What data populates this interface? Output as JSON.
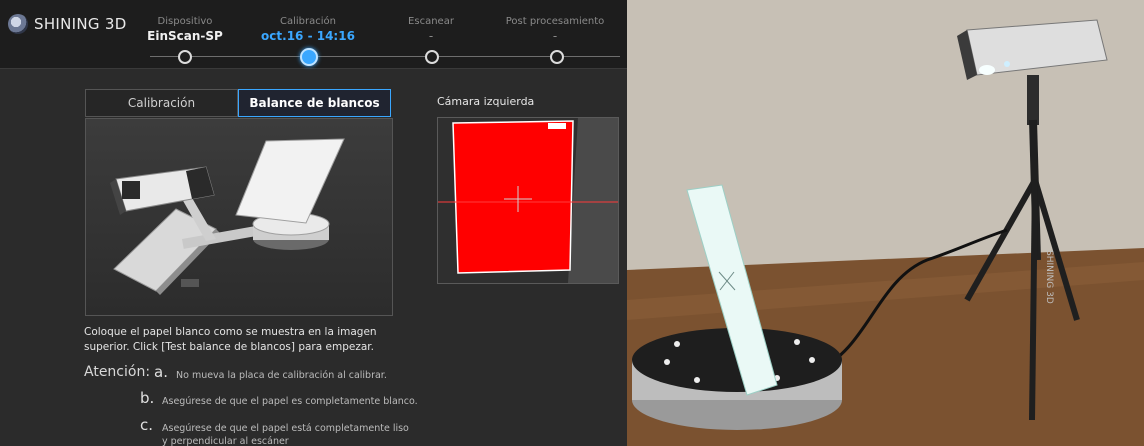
{
  "brand": {
    "name": "SHINING 3D"
  },
  "steps": [
    {
      "label": "Dispositivo",
      "value": "EinScan-SP",
      "state": "done"
    },
    {
      "label": "Calibración",
      "value": "oct.16 - 14:16",
      "state": "active"
    },
    {
      "label": "Escanear",
      "value": "-",
      "state": "pending"
    },
    {
      "label": "Post procesamiento",
      "value": "-",
      "state": "pending"
    }
  ],
  "tabs": {
    "calibration": "Calibración",
    "white_balance": "Balance de blancos"
  },
  "camera": {
    "label": "Cámara izquierda"
  },
  "instructions": {
    "main": "Coloque el papel blanco como se muestra en la imagen superior. Click [Test balance de blancos] para empezar.",
    "attention_label": "Atención:",
    "items": [
      {
        "letter": "a.",
        "text": "No mueva la placa de calibración al calibrar."
      },
      {
        "letter": "b.",
        "text": "Asegúrese de que el papel es completamente blanco."
      },
      {
        "letter": "c.",
        "text": "Asegúrese de que el papel está completamente liso y perpendicular al escáner"
      }
    ]
  },
  "photo": {
    "tripod_brand": "SHINING 3D"
  },
  "colors": {
    "accent": "#3aa7ff",
    "camera_overlay": "#ff0000",
    "background": "#2b2b2b"
  }
}
